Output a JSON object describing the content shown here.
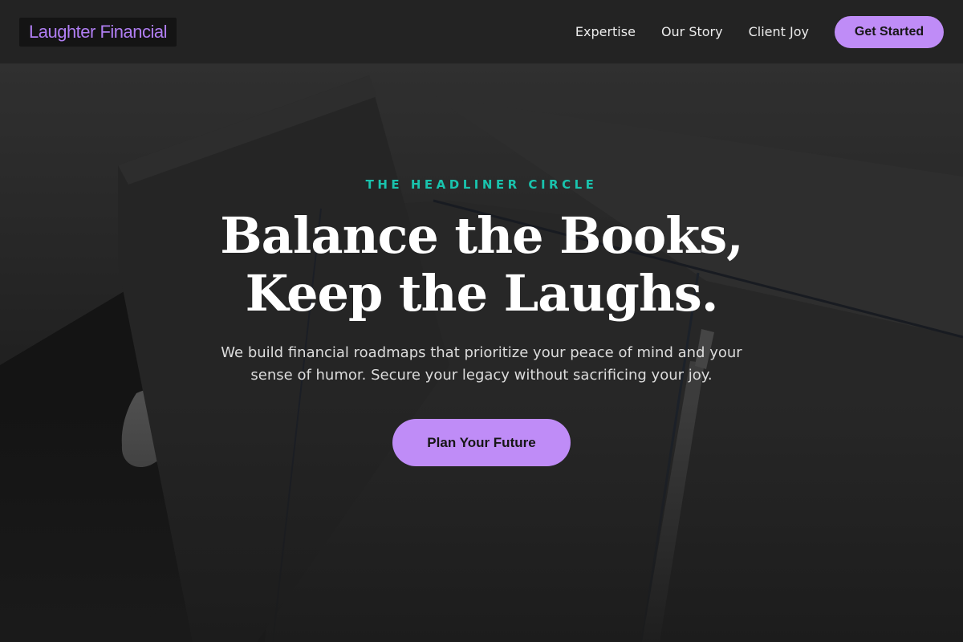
{
  "brand": {
    "name": "Laughter Financial"
  },
  "nav": {
    "links": [
      "Expertise",
      "Our Story",
      "Client Joy"
    ],
    "cta_label": "Get Started"
  },
  "hero": {
    "eyebrow": "THE HEADLINER CIRCLE",
    "headline_line1": "Balance the Books,",
    "headline_line2": "Keep the Laughs.",
    "subtitle": "We build financial roadmaps that prioritize your peace of mind and your sense of humor. Secure your legacy without sacrificing your joy.",
    "cta_label": "Plan Your Future"
  },
  "colors": {
    "accent": "#bf8cf7",
    "brand_text": "#b07ef2",
    "eyebrow": "#19c3ad",
    "nav_bg": "#232323"
  }
}
